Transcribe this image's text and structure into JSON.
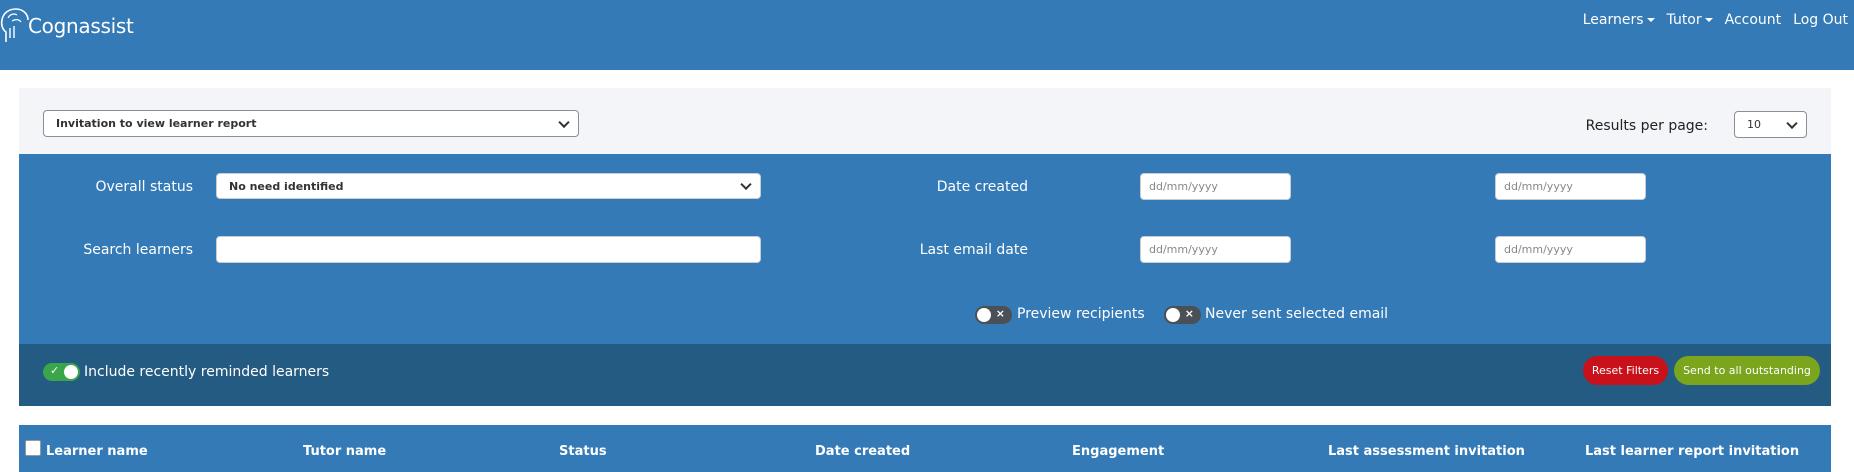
{
  "brand": {
    "name": "Cognassist",
    "logo_icon": "brain-head-icon"
  },
  "nav": {
    "learners": "Learners",
    "tutor": "Tutor",
    "account": "Account",
    "logout": "Log Out"
  },
  "email_type_select": {
    "value": "Invitation to view learner report"
  },
  "results_per_page": {
    "label": "Results per page:",
    "value": "10"
  },
  "filters": {
    "overall_status": {
      "label": "Overall status",
      "value": "No need identified"
    },
    "search_learners": {
      "label": "Search learners",
      "value": ""
    },
    "date_created": {
      "label": "Date created",
      "from_placeholder": "dd/mm/yyyy",
      "to_placeholder": "dd/mm/yyyy"
    },
    "last_email_date": {
      "label": "Last email date",
      "from_placeholder": "dd/mm/yyyy",
      "to_placeholder": "dd/mm/yyyy"
    },
    "preview_recipients": {
      "label": "Preview recipients",
      "on": false
    },
    "never_sent": {
      "label": "Never sent selected email",
      "on": false
    }
  },
  "recently_reminded": {
    "label": "Include recently reminded learners",
    "on": true
  },
  "buttons": {
    "reset": "Reset Filters",
    "send_all": "Send to all outstanding"
  },
  "table": {
    "columns": [
      "Learner name",
      "Tutor name",
      "Status",
      "Date created",
      "Engagement",
      "Last assessment invitation",
      "Last learner report invitation"
    ]
  },
  "colors": {
    "primary": "#337ab7",
    "dark": "#245b82",
    "danger": "#c8111a",
    "success": "#7aa51c",
    "toggle_on": "#3aa54b"
  }
}
